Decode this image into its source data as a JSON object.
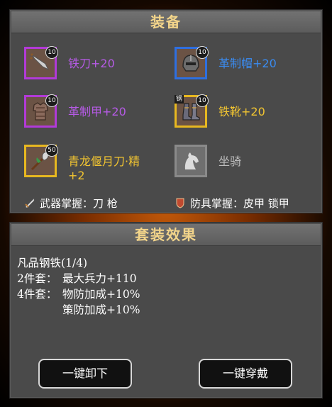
{
  "equipment": {
    "title": "装备",
    "slots": [
      {
        "name": "铁刀+20",
        "level": "10",
        "quality": "purple",
        "icon": "blade-icon",
        "tag": ""
      },
      {
        "name": "革制帽+20",
        "level": "10",
        "quality": "blue",
        "icon": "helmet-icon",
        "tag": ""
      },
      {
        "name": "革制甲+20",
        "level": "10",
        "quality": "purple",
        "icon": "armor-icon",
        "tag": ""
      },
      {
        "name": "铁靴+20",
        "level": "10",
        "quality": "gold",
        "icon": "boots-icon",
        "tag": "钢"
      },
      {
        "name": "青龙偃月刀·精+2",
        "level": "50",
        "quality": "gold",
        "icon": "glaive-icon",
        "tag": ""
      },
      {
        "name": "坐骑",
        "level": "",
        "quality": "empty",
        "icon": "horse-icon",
        "tag": ""
      }
    ],
    "weapon_mastery": "武器掌握：刀 枪",
    "armor_mastery": "防具掌握：皮甲 锁甲"
  },
  "set_effect": {
    "title": "套装效果",
    "set_name": "凡品钢铁(1/4)",
    "bonuses": [
      {
        "label": "2件套：",
        "effect": "最大兵力+110"
      },
      {
        "label": "4件套：",
        "effect": "物防加成+10%"
      },
      {
        "label": "",
        "effect": "策防加成+10%"
      }
    ]
  },
  "buttons": {
    "unequip_all": "一键卸下",
    "equip_all": "一键穿戴"
  },
  "colors": {
    "purple": "#b65be6",
    "blue": "#3a8cf2",
    "gold": "#f2c531",
    "header_text": "#f2d48a"
  }
}
